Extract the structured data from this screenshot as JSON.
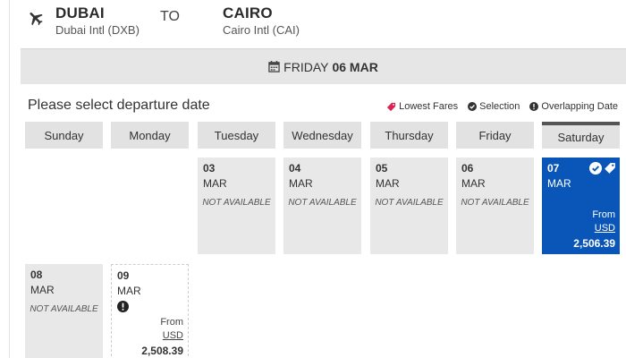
{
  "route": {
    "origin_city": "DUBAI",
    "origin_airport": "Dubai Intl (DXB)",
    "to_label": "TO",
    "dest_city": "CAIRO",
    "dest_airport": "Cairo Intl (CAI)"
  },
  "banner": {
    "day": "FRIDAY",
    "date": "06 MAR"
  },
  "prompt": "Please select departure date",
  "legend": {
    "lowest_fares": "Lowest Fares",
    "selection": "Selection",
    "overlapping": "Overlapping Date"
  },
  "weekdays": [
    "Sunday",
    "Monday",
    "Tuesday",
    "Wednesday",
    "Thursday",
    "Friday",
    "Saturday"
  ],
  "days": [
    {
      "num": "03",
      "month": "MAR",
      "status": "NOT AVAILABLE"
    },
    {
      "num": "04",
      "month": "MAR",
      "status": "NOT AVAILABLE"
    },
    {
      "num": "05",
      "month": "MAR",
      "status": "NOT AVAILABLE"
    },
    {
      "num": "06",
      "month": "MAR",
      "status": "NOT AVAILABLE"
    },
    {
      "num": "07",
      "month": "MAR",
      "from": "From",
      "currency": "USD",
      "price": "2,506.39"
    },
    {
      "num": "08",
      "month": "MAR",
      "status": "NOT AVAILABLE"
    },
    {
      "num": "09",
      "month": "MAR",
      "from": "From",
      "currency": "USD",
      "price": "2,508.39"
    }
  ],
  "colors": {
    "selected": "#0a56b8",
    "lowest_fares_tag": "#d8264f",
    "header_gray": "#e2e2e2"
  },
  "icons": {
    "route": "plane-icon",
    "banner": "calendar-icon",
    "lowest_fares": "tag-icon",
    "selection": "check-circle-icon",
    "overlapping": "exclamation-circle-icon"
  }
}
